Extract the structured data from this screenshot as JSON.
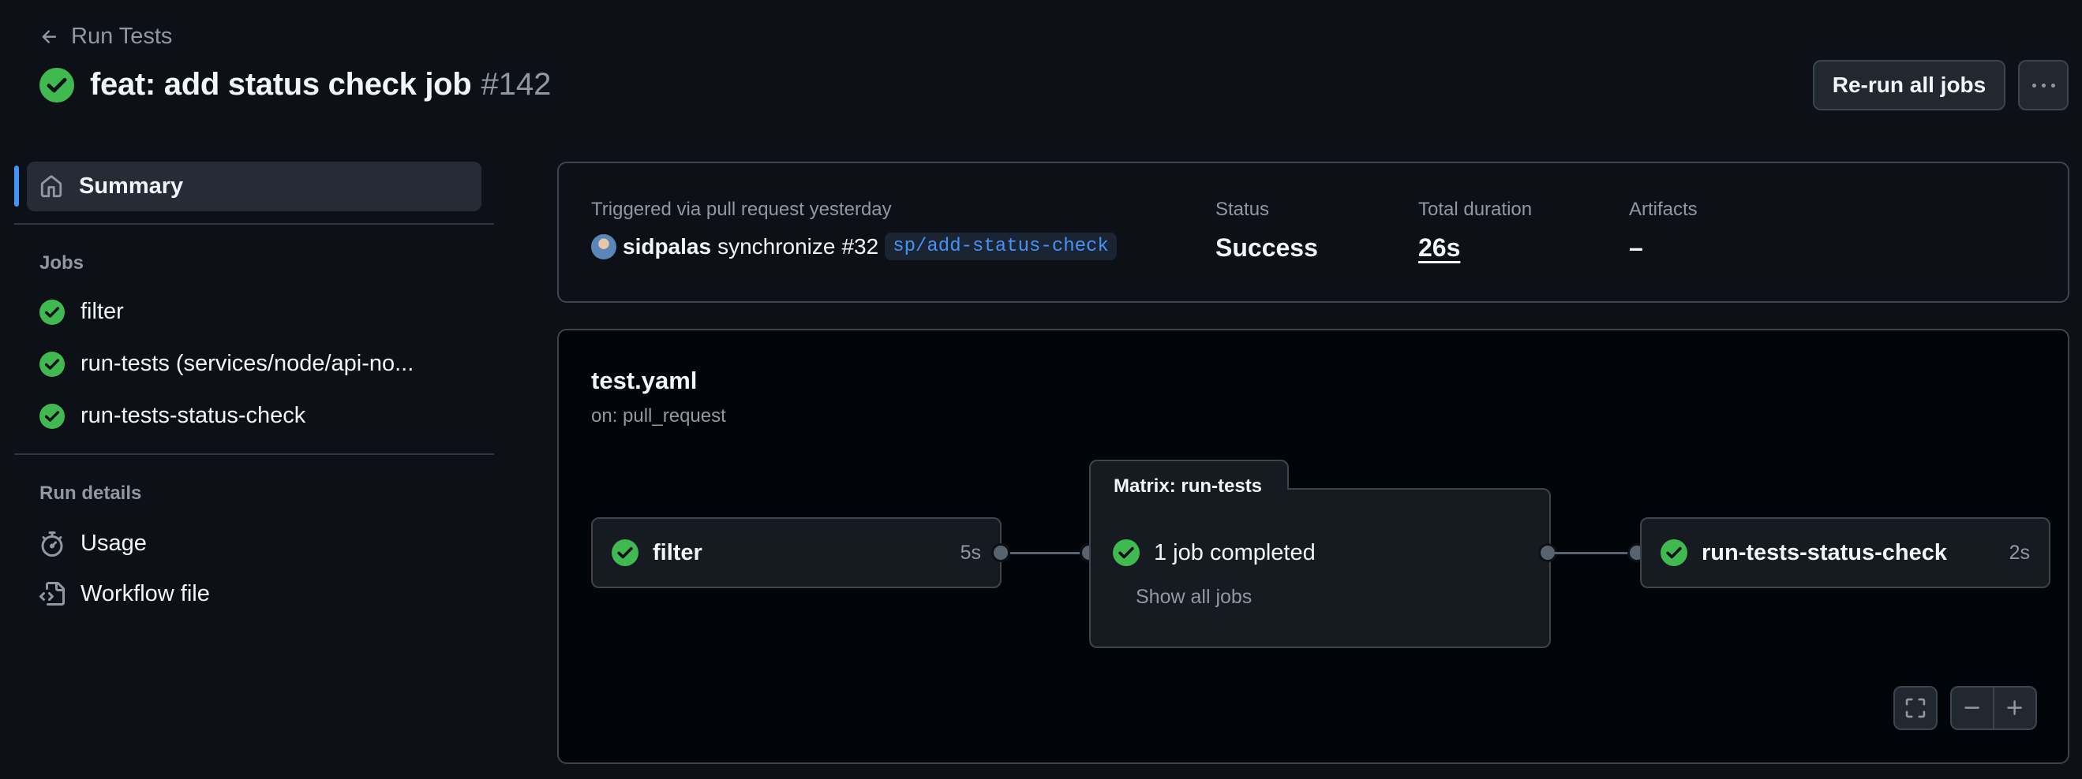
{
  "header": {
    "back_label": "Run Tests",
    "title": "feat: add status check job",
    "run_number": "#142",
    "rerun_label": "Re-run all jobs",
    "more_label": "···"
  },
  "sidebar": {
    "summary_label": "Summary",
    "jobs_heading": "Jobs",
    "jobs": [
      {
        "label": "filter",
        "icon": "success-check-icon"
      },
      {
        "label": "run-tests (services/node/api-no...",
        "icon": "success-check-icon"
      },
      {
        "label": "run-tests-status-check",
        "icon": "success-check-icon"
      }
    ],
    "details_heading": "Run details",
    "details": [
      {
        "label": "Usage",
        "icon": "stopwatch-icon"
      },
      {
        "label": "Workflow file",
        "icon": "file-code-icon"
      }
    ]
  },
  "summary": {
    "trigger_label": "Triggered via pull request yesterday",
    "actor": "sidpalas",
    "action": "synchronize",
    "pr": "#32",
    "branch": "sp/add-status-check",
    "status_label": "Status",
    "status_value": "Success",
    "duration_label": "Total duration",
    "duration_value": "26s",
    "artifacts_label": "Artifacts",
    "artifacts_value": "–"
  },
  "graph": {
    "workflow_name": "test.yaml",
    "trigger": "on: pull_request",
    "nodes": [
      {
        "name": "filter",
        "duration": "5s"
      },
      {
        "name": "run-tests-status-check",
        "duration": "2s"
      }
    ],
    "matrix": {
      "tab_label": "Matrix: run-tests",
      "summary": "1 job completed",
      "show_all": "Show all jobs"
    }
  },
  "colors": {
    "background": "#0d1117",
    "success": "#3fb950",
    "accent": "#4493f8",
    "border": "#3d444d"
  }
}
